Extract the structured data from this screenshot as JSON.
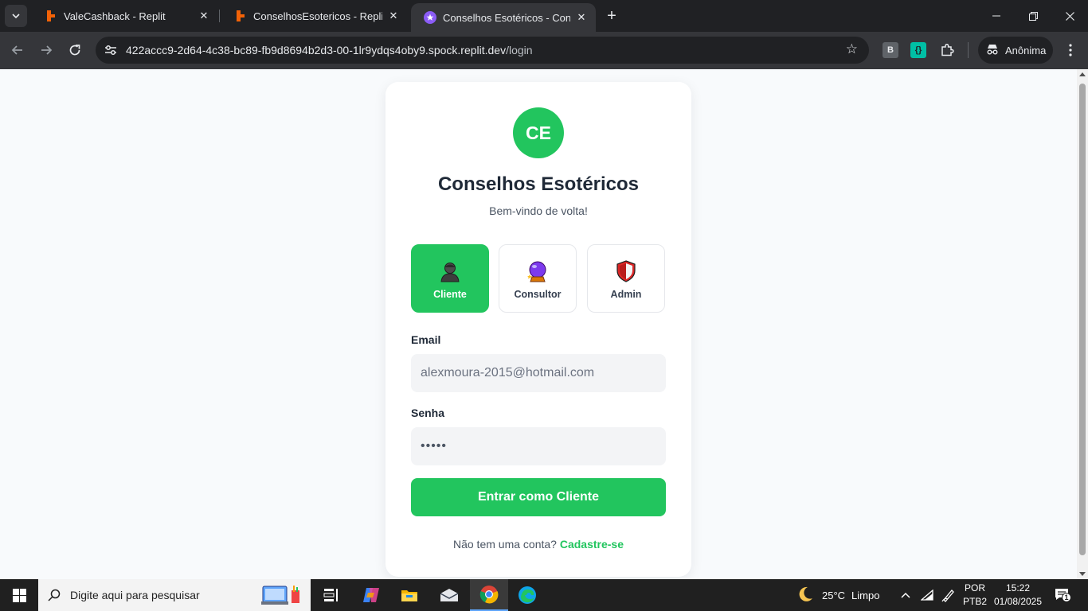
{
  "tabs": [
    {
      "title": "ValeCashback - Replit",
      "favicon": "replit-icon"
    },
    {
      "title": "ConselhosEsotericos - Replit",
      "favicon": "replit-icon"
    },
    {
      "title": "Conselhos Esotéricos - Consulta",
      "favicon": "star-icon",
      "active": true
    }
  ],
  "address_bar": {
    "host": "422accc9-2d64-4c38-bc89-fb9d8694b2d3-00-1lr9ydqs4oby9.spock.replit.dev",
    "path": "/login"
  },
  "extensions": [
    {
      "label": "B",
      "name": "b-extension-icon"
    },
    {
      "label": "{}",
      "name": "json-extension-icon"
    }
  ],
  "incognito_label": "Anônima",
  "colors": {
    "accent": "#22c55e",
    "chrome_dark": "#202124",
    "chrome_toolbar": "#35363a"
  },
  "login": {
    "logo_initials": "CE",
    "brand": "Conselhos Esotéricos",
    "subtitle": "Bem-vindo de volta!",
    "roles": [
      {
        "label": "Cliente",
        "icon": "person-icon",
        "selected": true
      },
      {
        "label": "Consultor",
        "icon": "crystal-ball-icon",
        "selected": false
      },
      {
        "label": "Admin",
        "icon": "shield-icon",
        "selected": false
      }
    ],
    "email_label": "Email",
    "email_value": "alexmoura-2015@hotmail.com",
    "password_label": "Senha",
    "password_value": "•••••",
    "submit_label": "Entrar como Cliente",
    "signup_prompt": "Não tem uma conta?",
    "signup_link": "Cadastre-se"
  },
  "taskbar": {
    "search_placeholder": "Digite aqui para pesquisar",
    "apps": [
      "task-view-icon",
      "copilot-icon",
      "file-explorer-icon",
      "mail-icon",
      "chrome-icon",
      "edge-icon"
    ],
    "weather": {
      "temp": "25°C",
      "condition": "Limpo"
    },
    "language": {
      "lang": "POR",
      "layout": "PTB2"
    },
    "clock": {
      "time": "15:22",
      "date": "01/08/2025"
    },
    "notifications_count": "1"
  }
}
